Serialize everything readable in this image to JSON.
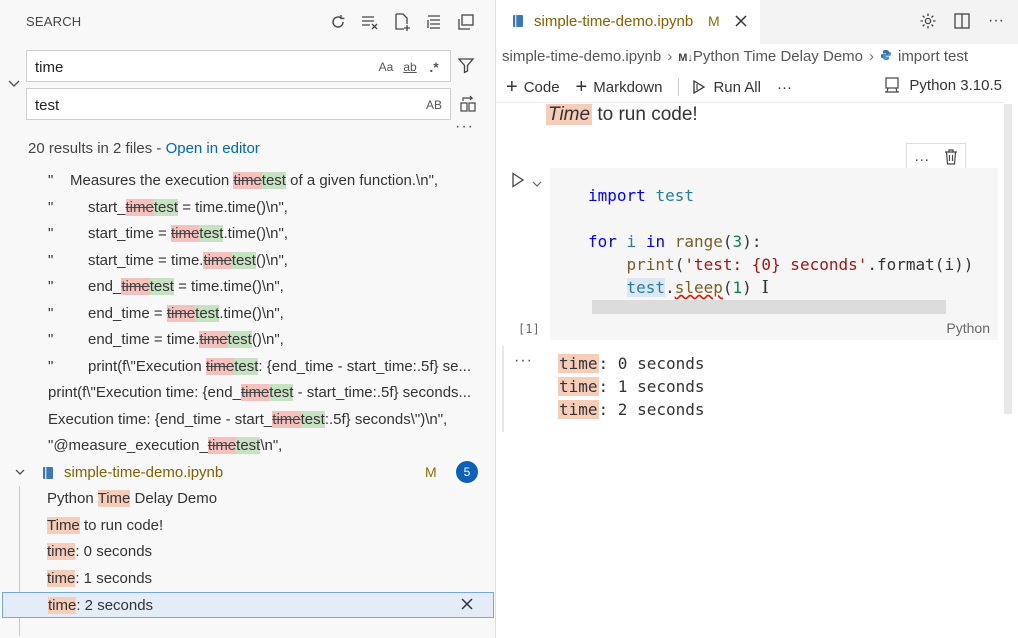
{
  "search_pane": {
    "title": "SEARCH",
    "actions": [
      "refresh-icon",
      "clear-results-icon",
      "new-search-editor-icon",
      "collapse-all-icon",
      "view-as-tree-icon"
    ],
    "search_value": "time",
    "search_options": [
      "Aa",
      "ab",
      ".*"
    ],
    "replace_value": "test",
    "replace_options": [
      "AB"
    ],
    "summary_text": "20 results in 2 files - ",
    "open_in_editor": "Open in editor",
    "results": [
      {
        "quote": "\"",
        "pre": "Measures the execution ",
        "del": "time",
        "ins": "test",
        "post": " of a given function.\\n\","
      },
      {
        "quote": "\"",
        "pre": "start_",
        "del": "time",
        "ins": "test",
        "post": " = time.time()\\n\","
      },
      {
        "quote": "\"",
        "pre": "start_time = ",
        "del": "time",
        "ins": "test",
        "post": ".time()\\n\","
      },
      {
        "quote": "\"",
        "pre": "start_time = time.",
        "del": "time",
        "ins": "test",
        "post": "()\\n\","
      },
      {
        "quote": "\"",
        "pre": "end_",
        "del": "time",
        "ins": "test",
        "post": " = time.time()\\n\","
      },
      {
        "quote": "\"",
        "pre": "end_time = ",
        "del": "time",
        "ins": "test",
        "post": ".time()\\n\","
      },
      {
        "quote": "\"",
        "pre": "end_time = time.",
        "del": "time",
        "ins": "test",
        "post": "()\\n\","
      },
      {
        "quote": "\"",
        "pre": "print(f\\\"Execution ",
        "del": "time",
        "ins": "test",
        "post": ": {end_time - start_time:.5f} se..."
      },
      {
        "quote": "",
        "pre": "print(f\\\"Execution time: {end_",
        "del": "time",
        "ins": "test",
        "post": " - start_time:.5f} seconds..."
      },
      {
        "quote": "",
        "pre": "Execution time: {end_time - start_",
        "del": "time",
        "ins": "test",
        "post": ":.5f} seconds\\\")\\n\","
      },
      {
        "quote": "",
        "pre": "\"@measure_execution_",
        "del": "time",
        "ins": "test",
        "post": "\\n\","
      }
    ],
    "file_group": {
      "name": "simple-time-demo.ipynb",
      "status": "M",
      "count": "5",
      "matches": [
        {
          "pre": "Python ",
          "hit": "Time",
          "post": " Delay Demo"
        },
        {
          "pre": "",
          "hit": "Time",
          "post": " to run code!"
        },
        {
          "pre": "",
          "hit": "time",
          "post": ": 0 seconds"
        },
        {
          "pre": "",
          "hit": "time",
          "post": ": 1 seconds"
        },
        {
          "pre": "",
          "hit": "time",
          "post": ": 2 seconds"
        }
      ]
    }
  },
  "editor": {
    "tab_title": "simple-time-demo.ipynb",
    "tab_status": "M",
    "breadcrumb": [
      "simple-time-demo.ipynb",
      "Python Time Delay Demo",
      "import test"
    ],
    "breadcrumb_md_badge": "M↓",
    "toolbar": {
      "code": "Code",
      "markdown": "Markdown",
      "run_all": "Run All",
      "more": "···"
    },
    "kernel": "Python 3.10.5",
    "markdown_line": {
      "hit": "Time",
      "rest": " to run code!"
    },
    "code_lines": {
      "l1_kw": "import",
      "l1_id": "test",
      "l2_kw1": "for",
      "l2_var": "i",
      "l2_kw2": "in",
      "l2_fn": "range",
      "l2_num": "3",
      "l3_fn": "print",
      "l3_str": "'test: {0} seconds'",
      "l3_method": ".format(i))",
      "l4_obj": "test",
      "l4_fn": "sleep",
      "l4_num": "1"
    },
    "exec_count": "[1]",
    "cell_language": "Python",
    "outputs": [
      {
        "hit": "time",
        "rest": ": 0 seconds"
      },
      {
        "hit": "time",
        "rest": ": 1 seconds"
      },
      {
        "hit": "time",
        "rest": ": 2 seconds"
      }
    ]
  }
}
